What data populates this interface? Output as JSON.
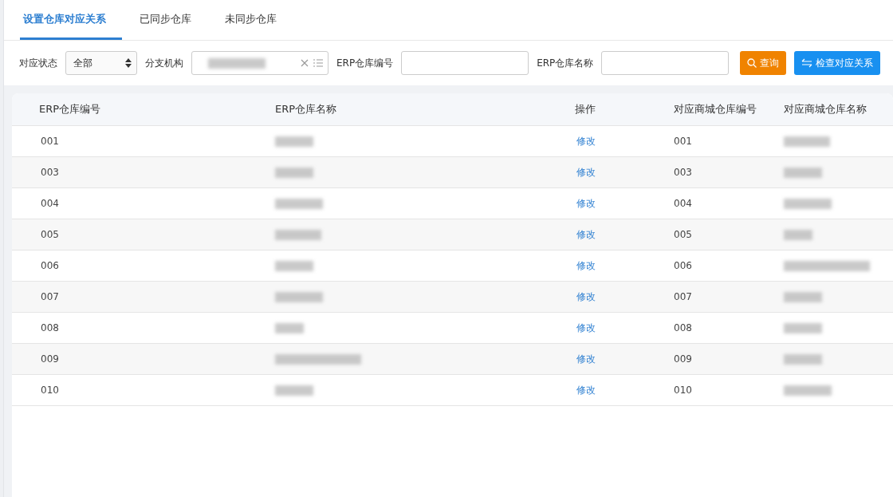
{
  "tabs": [
    {
      "label": "设置仓库对应关系",
      "selected": true
    },
    {
      "label": "已同步仓库",
      "selected": false
    },
    {
      "label": "未同步仓库",
      "selected": false
    }
  ],
  "filters": {
    "status": {
      "label": "对应状态",
      "value": "全部"
    },
    "branch": {
      "label": "分支机构"
    },
    "erp_code": {
      "label": "ERP仓库编号"
    },
    "erp_name": {
      "label": "ERP仓库名称"
    }
  },
  "buttons": {
    "query": "查询",
    "check": "检查对应关系"
  },
  "table": {
    "columns": [
      "ERP仓库编号",
      "ERP仓库名称",
      "操作",
      "对应商城仓库编号",
      "对应商城仓库名称"
    ],
    "rows": [
      {
        "erp_code": "001",
        "action": "修改",
        "mall_code": "001"
      },
      {
        "erp_code": "003",
        "action": "修改",
        "mall_code": "003"
      },
      {
        "erp_code": "004",
        "action": "修改",
        "mall_code": "004"
      },
      {
        "erp_code": "005",
        "action": "修改",
        "mall_code": "005"
      },
      {
        "erp_code": "006",
        "action": "修改",
        "mall_code": "006"
      },
      {
        "erp_code": "007",
        "action": "修改",
        "mall_code": "007"
      },
      {
        "erp_code": "008",
        "action": "修改",
        "mall_code": "008"
      },
      {
        "erp_code": "009",
        "action": "修改",
        "mall_code": "009"
      },
      {
        "erp_code": "010",
        "action": "修改",
        "mall_code": "010"
      }
    ]
  }
}
